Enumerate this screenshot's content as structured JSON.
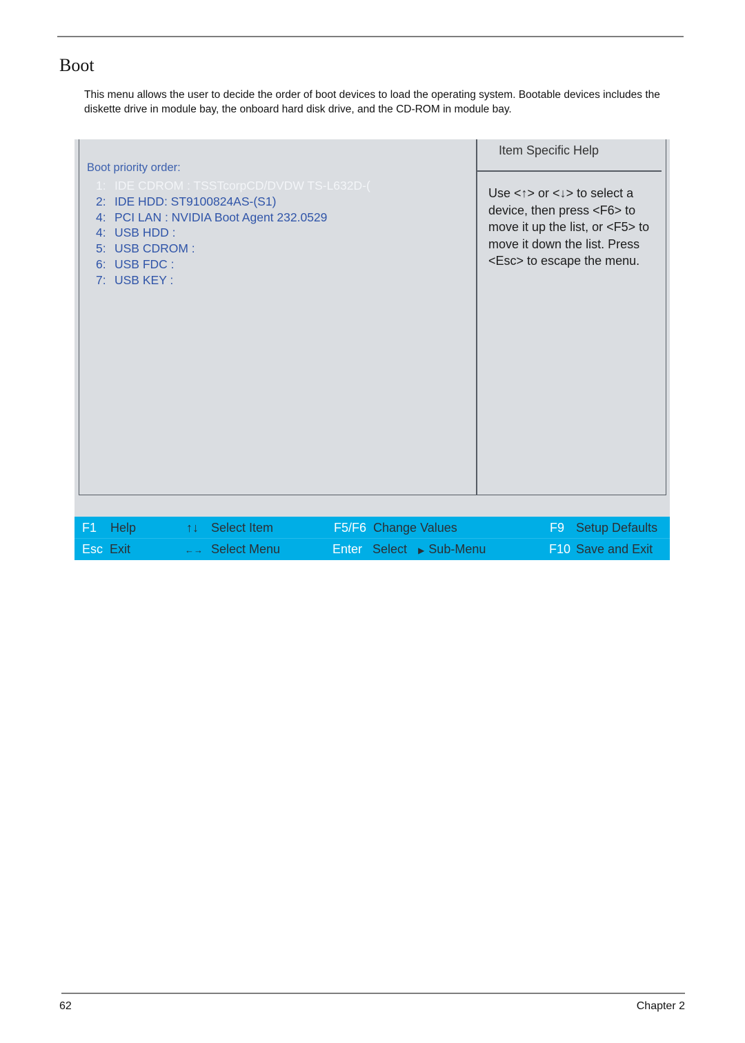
{
  "page": {
    "title": "Boot",
    "intro": "This menu allows the user to decide the order of boot devices to load the operating system. Bootable devices includes the diskette drive in module bay, the onboard hard disk drive, and the CD-ROM in module bay."
  },
  "bios": {
    "section_label": "Boot priority order:",
    "boot_items": [
      {
        "num": "1:",
        "label": "IDE CDROM : TSSTcorpCD/DVDW TS-L632D-(",
        "selected": true
      },
      {
        "num": "2:",
        "label": "IDE HDD: ST9100824AS-(S1)",
        "selected": false
      },
      {
        "num": "4:",
        "label": "PCI LAN : NVIDIA Boot Agent 232.0529",
        "selected": false
      },
      {
        "num": "4:",
        "label": "USB HDD :",
        "selected": false
      },
      {
        "num": "5:",
        "label": "USB CDROM :",
        "selected": false
      },
      {
        "num": "6:",
        "label": "USB FDC :",
        "selected": false
      },
      {
        "num": "7:",
        "label": "USB KEY :",
        "selected": false
      }
    ],
    "help": {
      "title": "Item Specific Help",
      "text_parts": {
        "use": "Use <",
        "up_arrow": "↑",
        "or": "> or <",
        "down_arrow": "↓",
        "rest": "> to select a device, then press <F6> to move it up the list, or <F5> to move it down the list. Press <Esc> to escape the menu."
      }
    },
    "keybar": {
      "row1": [
        {
          "key": "F1",
          "desc": "Help"
        },
        {
          "key": "↑↓",
          "desc": "Select Item",
          "icon": "up-down-arrows-icon"
        },
        {
          "key": "F5/F6",
          "desc": "Change Values"
        },
        {
          "key": "F9",
          "desc": "Setup Defaults"
        }
      ],
      "row2": [
        {
          "key": "Esc",
          "desc": "Exit"
        },
        {
          "key": "←→",
          "desc": "Select Menu",
          "icon": "left-right-arrows-icon"
        },
        {
          "key": "Enter",
          "desc": "Select",
          "submenu_glyph": "▶",
          "submenu_label": "Sub-Menu"
        },
        {
          "key": "F10",
          "desc": "Save and Exit"
        }
      ],
      "colors": {
        "bar": "#00aee6",
        "key": "#ffffff",
        "desc": "#2c2f33"
      }
    },
    "colors": {
      "panel": "#dadde1",
      "item_text": "#2f54a8",
      "selected_text": "#f3f5f8"
    }
  },
  "footer": {
    "page_number": "62",
    "chapter": "Chapter 2"
  }
}
